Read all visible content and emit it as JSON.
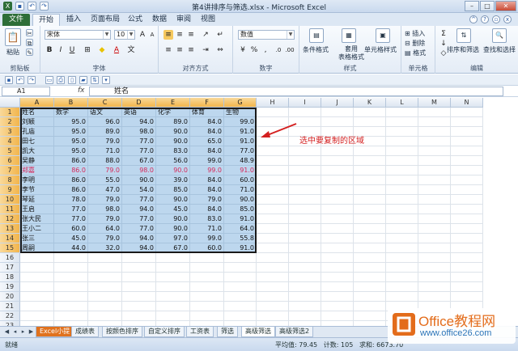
{
  "window": {
    "title": "第4讲排序与筛选.xlsx - Microsoft Excel"
  },
  "ribbon_tabs": [
    "文件",
    "开始",
    "插入",
    "页面布局",
    "公式",
    "数据",
    "审阅",
    "视图"
  ],
  "ribbon": {
    "clipboard": {
      "group_label": "剪贴板",
      "paste": "粘贴"
    },
    "font": {
      "group_label": "字体",
      "font_name": "宋体",
      "font_size": "10",
      "bold": "B",
      "italic": "I",
      "underline": "U"
    },
    "alignment": {
      "group_label": "对齐方式"
    },
    "number": {
      "group_label": "数字",
      "format": "数值"
    },
    "styles": {
      "group_label": "样式",
      "conditional": "条件格式",
      "table": "套用\n表格格式",
      "cell_styles": "单元格样式"
    },
    "cells": {
      "group_label": "单元格",
      "insert": "插入",
      "delete": "删除",
      "format": "格式"
    },
    "editing": {
      "group_label": "编辑",
      "sort_filter": "排序和筛选",
      "find_select": "查找和选择"
    }
  },
  "formula_bar": {
    "name_box": "A1",
    "fx": "fx",
    "value": "姓名"
  },
  "columns": [
    "A",
    "B",
    "C",
    "D",
    "E",
    "F",
    "G",
    "H",
    "I",
    "J",
    "K",
    "L",
    "M",
    "N"
  ],
  "rows": [
    [
      "姓名",
      "数学",
      "语文",
      "英语",
      "化学",
      "体育",
      "生物"
    ],
    [
      "刘颖",
      "95.0",
      "96.0",
      "94.0",
      "89.0",
      "84.0",
      "99.0"
    ],
    [
      "孔庙",
      "95.0",
      "89.0",
      "98.0",
      "90.0",
      "84.0",
      "91.0"
    ],
    [
      "田七",
      "95.0",
      "79.0",
      "77.0",
      "90.0",
      "65.0",
      "91.0"
    ],
    [
      "凯大",
      "95.0",
      "71.0",
      "77.0",
      "83.0",
      "84.0",
      "77.0"
    ],
    [
      "吴静",
      "86.0",
      "88.0",
      "67.0",
      "56.0",
      "99.0",
      "48.9"
    ],
    [
      "郑嘉",
      "86.0",
      "79.0",
      "98.0",
      "90.0",
      "99.0",
      "91.0"
    ],
    [
      "李明",
      "86.0",
      "55.0",
      "90.0",
      "39.0",
      "84.0",
      "60.0"
    ],
    [
      "李节",
      "86.0",
      "47.0",
      "54.0",
      "85.0",
      "84.0",
      "71.0"
    ],
    [
      "琴延",
      "78.0",
      "79.0",
      "77.0",
      "90.0",
      "79.0",
      "90.0"
    ],
    [
      "王启",
      "77.0",
      "98.0",
      "94.0",
      "45.0",
      "84.0",
      "85.0"
    ],
    [
      "张大民",
      "77.0",
      "79.0",
      "77.0",
      "90.0",
      "83.0",
      "91.0"
    ],
    [
      "王小二",
      "60.0",
      "64.0",
      "77.0",
      "90.0",
      "71.0",
      "64.0"
    ],
    [
      "张三",
      "45.0",
      "79.0",
      "94.0",
      "97.0",
      "99.0",
      "55.8"
    ],
    [
      "周嗣",
      "44.0",
      "32.0",
      "94.0",
      "67.0",
      "60.0",
      "91.0"
    ]
  ],
  "highlight_row_name": "郑嘉",
  "annotation": "选中要复制的区域",
  "sheet_tabs": [
    "Excel小提",
    "成绩表",
    "按颜色排序",
    "自定义排序",
    "工资表",
    "筛选",
    "高级筛选",
    "高级筛选2"
  ],
  "status": {
    "ready": "就绪",
    "average": "平均值: 79.45",
    "count": "计数: 105",
    "sum": "求和: 6673.70"
  },
  "watermark": {
    "brand": "Office教程网",
    "url": "www.office26.com"
  },
  "colors": {
    "selection": "#bdd7ee",
    "red_text": "#d6285a",
    "annotation": "#d42020",
    "file_tab": "#2e6e38",
    "brand": "#e36c1b"
  }
}
